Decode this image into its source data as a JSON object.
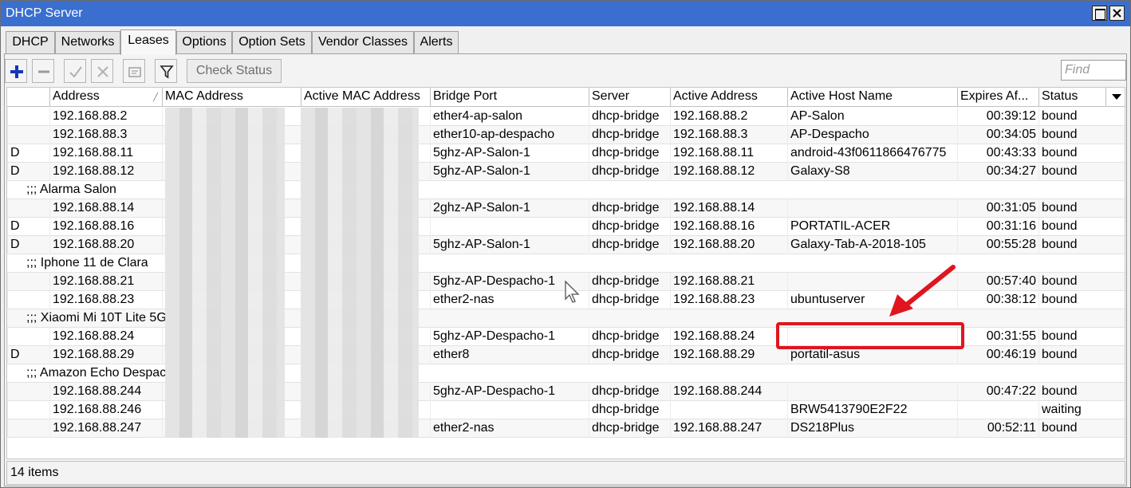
{
  "window": {
    "title": "DHCP Server"
  },
  "tabs": [
    "DHCP",
    "Networks",
    "Leases",
    "Options",
    "Option Sets",
    "Vendor Classes",
    "Alerts"
  ],
  "active_tab": "Leases",
  "toolbar": {
    "check_status": "Check Status",
    "find_placeholder": "Find"
  },
  "columns": [
    "Address",
    "MAC Address",
    "Active MAC Address",
    "Bridge Port",
    "Server",
    "Active Address",
    "Active Host Name",
    "Expires Af...",
    "Status"
  ],
  "rows": [
    {
      "type": "lease",
      "flag": "",
      "address": "192.168.88.2",
      "bridge_port": "ether4-ap-salon",
      "server": "dhcp-bridge",
      "active_address": "192.168.88.2",
      "host": "AP-Salon",
      "expires": "00:39:12",
      "status": "bound"
    },
    {
      "type": "lease",
      "flag": "",
      "address": "192.168.88.3",
      "bridge_port": "ether10-ap-despacho",
      "server": "dhcp-bridge",
      "active_address": "192.168.88.3",
      "host": "AP-Despacho",
      "expires": "00:34:05",
      "status": "bound"
    },
    {
      "type": "lease",
      "flag": "D",
      "address": "192.168.88.11",
      "bridge_port": "5ghz-AP-Salon-1",
      "server": "dhcp-bridge",
      "active_address": "192.168.88.11",
      "host": "android-43f0611866476775",
      "expires": "00:43:33",
      "status": "bound"
    },
    {
      "type": "lease",
      "flag": "D",
      "address": "192.168.88.12",
      "bridge_port": "5ghz-AP-Salon-1",
      "server": "dhcp-bridge",
      "active_address": "192.168.88.12",
      "host": "Galaxy-S8",
      "expires": "00:34:27",
      "status": "bound"
    },
    {
      "type": "comment",
      "text": ";;; Alarma Salon"
    },
    {
      "type": "lease",
      "flag": "",
      "address": "192.168.88.14",
      "bridge_port": "2ghz-AP-Salon-1",
      "server": "dhcp-bridge",
      "active_address": "192.168.88.14",
      "host": "",
      "expires": "00:31:05",
      "status": "bound"
    },
    {
      "type": "lease",
      "flag": "D",
      "address": "192.168.88.16",
      "bridge_port": "",
      "server": "dhcp-bridge",
      "active_address": "192.168.88.16",
      "host": "PORTATIL-ACER",
      "expires": "00:31:16",
      "status": "bound"
    },
    {
      "type": "lease",
      "flag": "D",
      "address": "192.168.88.20",
      "bridge_port": "5ghz-AP-Salon-1",
      "server": "dhcp-bridge",
      "active_address": "192.168.88.20",
      "host": "Galaxy-Tab-A-2018-105",
      "expires": "00:55:28",
      "status": "bound"
    },
    {
      "type": "comment",
      "text": ";;; Iphone 11 de Clara"
    },
    {
      "type": "lease",
      "flag": "",
      "address": "192.168.88.21",
      "bridge_port": "5ghz-AP-Despacho-1",
      "server": "dhcp-bridge",
      "active_address": "192.168.88.21",
      "host": "",
      "expires": "00:57:40",
      "status": "bound"
    },
    {
      "type": "lease",
      "flag": "",
      "address": "192.168.88.23",
      "bridge_port": "ether2-nas",
      "server": "dhcp-bridge",
      "active_address": "192.168.88.23",
      "host": "ubuntuserver",
      "expires": "00:38:12",
      "status": "bound"
    },
    {
      "type": "comment",
      "text": ";;; Xiaomi Mi 10T Lite 5G"
    },
    {
      "type": "lease",
      "flag": "",
      "address": "192.168.88.24",
      "bridge_port": "5ghz-AP-Despacho-1",
      "server": "dhcp-bridge",
      "active_address": "192.168.88.24",
      "host": "",
      "expires": "00:31:55",
      "status": "bound"
    },
    {
      "type": "lease",
      "flag": "D",
      "address": "192.168.88.29",
      "bridge_port": "ether8",
      "server": "dhcp-bridge",
      "active_address": "192.168.88.29",
      "host": "portatil-asus",
      "expires": "00:46:19",
      "status": "bound"
    },
    {
      "type": "comment",
      "text": ";;; Amazon Echo Despac"
    },
    {
      "type": "lease",
      "flag": "",
      "address": "192.168.88.244",
      "bridge_port": "5ghz-AP-Despacho-1",
      "server": "dhcp-bridge",
      "active_address": "192.168.88.244",
      "host": "",
      "expires": "00:47:22",
      "status": "bound"
    },
    {
      "type": "lease",
      "flag": "",
      "address": "192.168.88.246",
      "bridge_port": "",
      "server": "dhcp-bridge",
      "active_address": "",
      "host": "BRW5413790E2F22",
      "expires": "",
      "status": "waiting"
    },
    {
      "type": "lease",
      "flag": "",
      "address": "192.168.88.247",
      "bridge_port": "ether2-nas",
      "server": "dhcp-bridge",
      "active_address": "192.168.88.247",
      "host": "DS218Plus",
      "expires": "00:52:11",
      "status": "bound"
    }
  ],
  "status_bar": {
    "count": "14 items"
  },
  "annotation": {
    "color": "#e0151f"
  }
}
